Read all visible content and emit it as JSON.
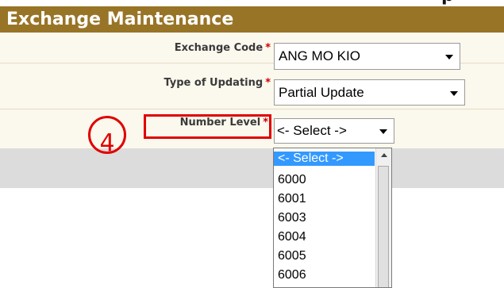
{
  "top_glyph": "p",
  "header": {
    "title": "Exchange Maintenance"
  },
  "form": {
    "exchange_code": {
      "label": "Exchange Code",
      "required_mark": "*",
      "value": "ANG MO KIO"
    },
    "type_of_updating": {
      "label": "Type of Updating",
      "required_mark": "*",
      "value": "Partial Update"
    },
    "number_level": {
      "label": "Number Level",
      "required_mark": "*",
      "value": "<- Select ->"
    }
  },
  "callout": {
    "number": "4",
    "color": "#e00000"
  },
  "dropdown": {
    "options": [
      "<- Select ->",
      "6000",
      "6001",
      "6003",
      "6004",
      "6005",
      "6006"
    ],
    "selected_index": 0
  },
  "colors": {
    "header_bg": "#987426",
    "form_bg": "#fbf8ed",
    "selected_bg": "#3399ff"
  }
}
